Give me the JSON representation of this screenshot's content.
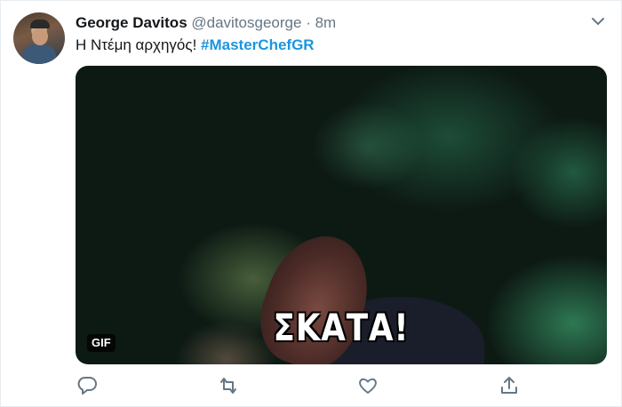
{
  "author": {
    "name": "George Davitos",
    "handle": "@davitosgeorge",
    "separator": "·",
    "time": "8m"
  },
  "tweet": {
    "text": "Η Ντέμη αρχηγός!",
    "hashtag": "#MasterChefGR"
  },
  "media": {
    "caption": "ΣΚΑΤΑ!",
    "badge": "GIF"
  },
  "icons": {
    "more": "chevron-down-icon",
    "reply": "reply-icon",
    "retweet": "retweet-icon",
    "like": "heart-icon",
    "share": "share-icon"
  },
  "colors": {
    "hashtag": "#1b95e0",
    "secondary_text": "#657786",
    "primary_text": "#14171a"
  }
}
